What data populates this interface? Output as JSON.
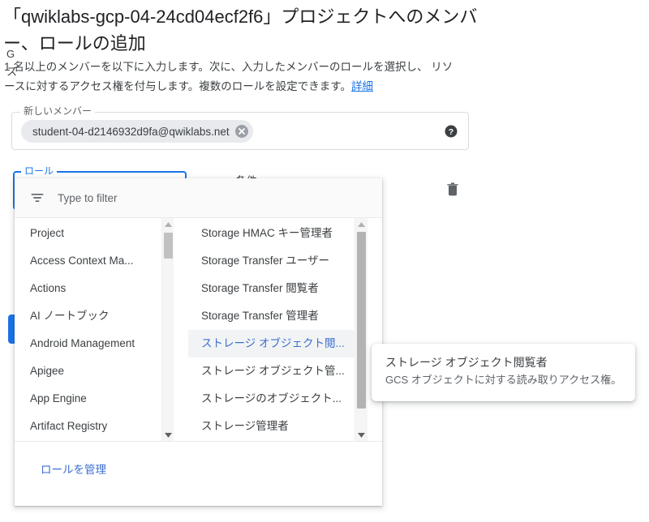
{
  "page": {
    "title": "「qwiklabs-gcp-04-24cd04ecf2f6」プロジェクトへのメンバー、ロールの追加",
    "description_line1": "1 名以上のメンバーを以下に入力します。次に、入力したメンバーのロールを選択し、",
    "description_line2": "リソースに対するアクセス権を付与します。複数のロールを設定できます。",
    "description_link": "詳細"
  },
  "member_field": {
    "legend": "新しいメンバー",
    "chip_label": "student-04-d2146932d9fa@qwiklabs.net",
    "help_icon": "help-circle-icon",
    "close_icon": "chip-remove-icon"
  },
  "role_field": {
    "legend": "ロール",
    "value_line1": "G",
    "value_line2": "ス",
    "condition_label": "条件",
    "delete_icon": "trash-icon",
    "save_label": ""
  },
  "dropdown": {
    "filter_placeholder": "Type to filter",
    "filter_value": "",
    "filter_icon": "filter-icon",
    "left_column": [
      "Project",
      "Access Context Ma...",
      "Actions",
      "AI ノートブック",
      "Android Management",
      "Apigee",
      "App Engine",
      "Artifact Registry"
    ],
    "right_column": [
      "Storage HMAC キー管理者",
      "Storage Transfer ユーザー",
      "Storage Transfer 閲覧者",
      "Storage Transfer 管理者",
      "ストレージ オブジェクト閲...",
      "ストレージ オブジェクト管...",
      "ストレージのオブジェクト...",
      "ストレージ管理者"
    ],
    "selected_right_index": 4,
    "footer_link": "ロールを管理"
  },
  "tooltip": {
    "title": "ストレージ オブジェクト閲覧者",
    "body": "GCS オブジェクトに対する読み取りアクセス権。"
  },
  "colors": {
    "accent": "#1a73e8",
    "link": "#3c6fd0",
    "text": "#3c4043",
    "muted": "#5f6368",
    "chip_bg": "#e8eaed",
    "selected_bg": "#f1f3f4"
  }
}
